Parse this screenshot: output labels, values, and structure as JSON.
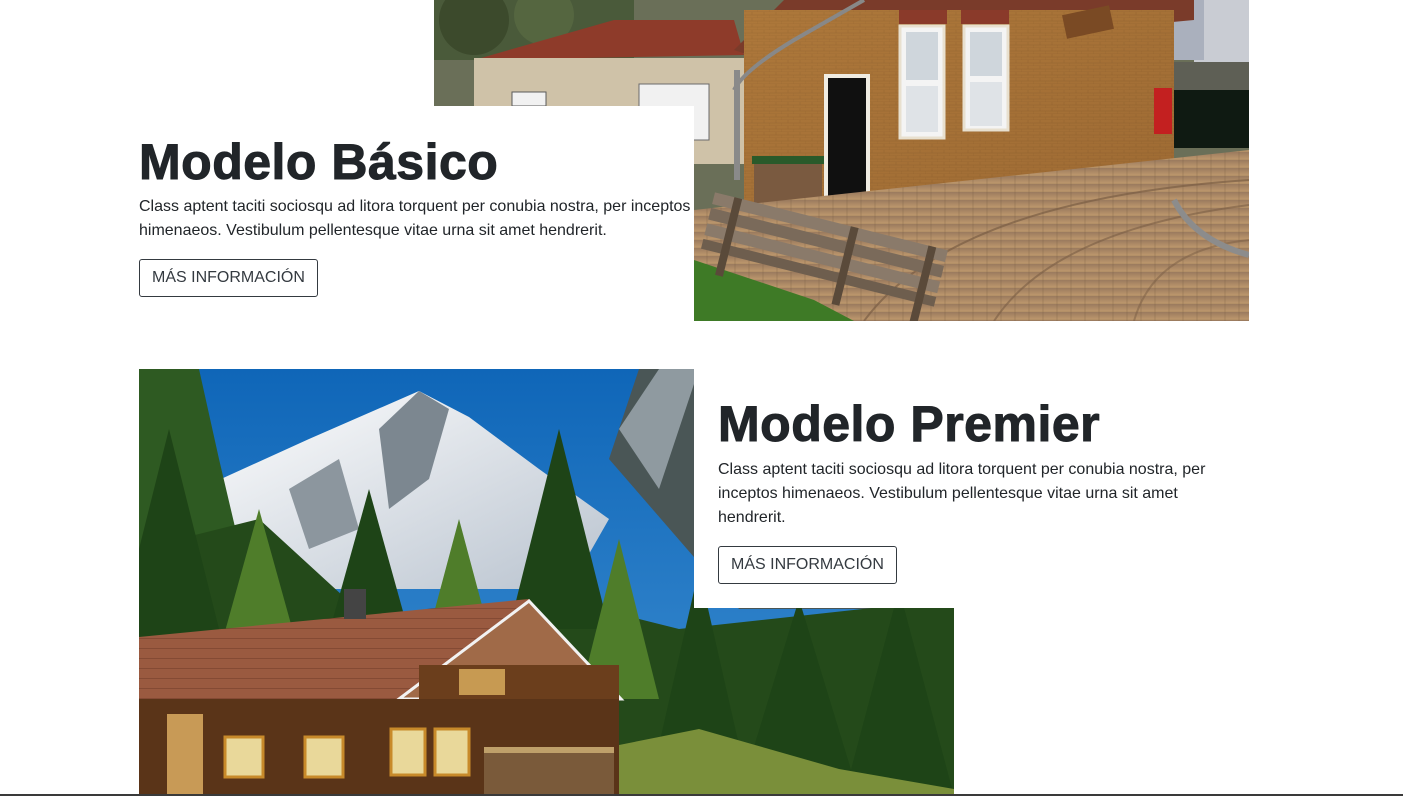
{
  "sections": [
    {
      "title": "Modelo Básico",
      "text": "Class aptent taciti sociosqu ad litora torquent per conubia nostra, per inceptos himenaeos. Vestibulum pellentesque vitae urna sit amet hendrerit.",
      "button_label": "MÁS INFORMACIÓN",
      "image_icon": "brick-houses-photo"
    },
    {
      "title": "Modelo Premier",
      "text": "Class aptent taciti sociosqu ad litora torquent per conubia nostra, per inceptos himenaeos. Vestibulum pellentesque vitae urna sit amet hendrerit.",
      "button_label": "MÁS INFORMACIÓN",
      "image_icon": "alpine-cabin-photo"
    }
  ],
  "colors": {
    "heading": "#212529",
    "text": "#212529",
    "button_border": "#343a40",
    "background": "#ffffff"
  }
}
